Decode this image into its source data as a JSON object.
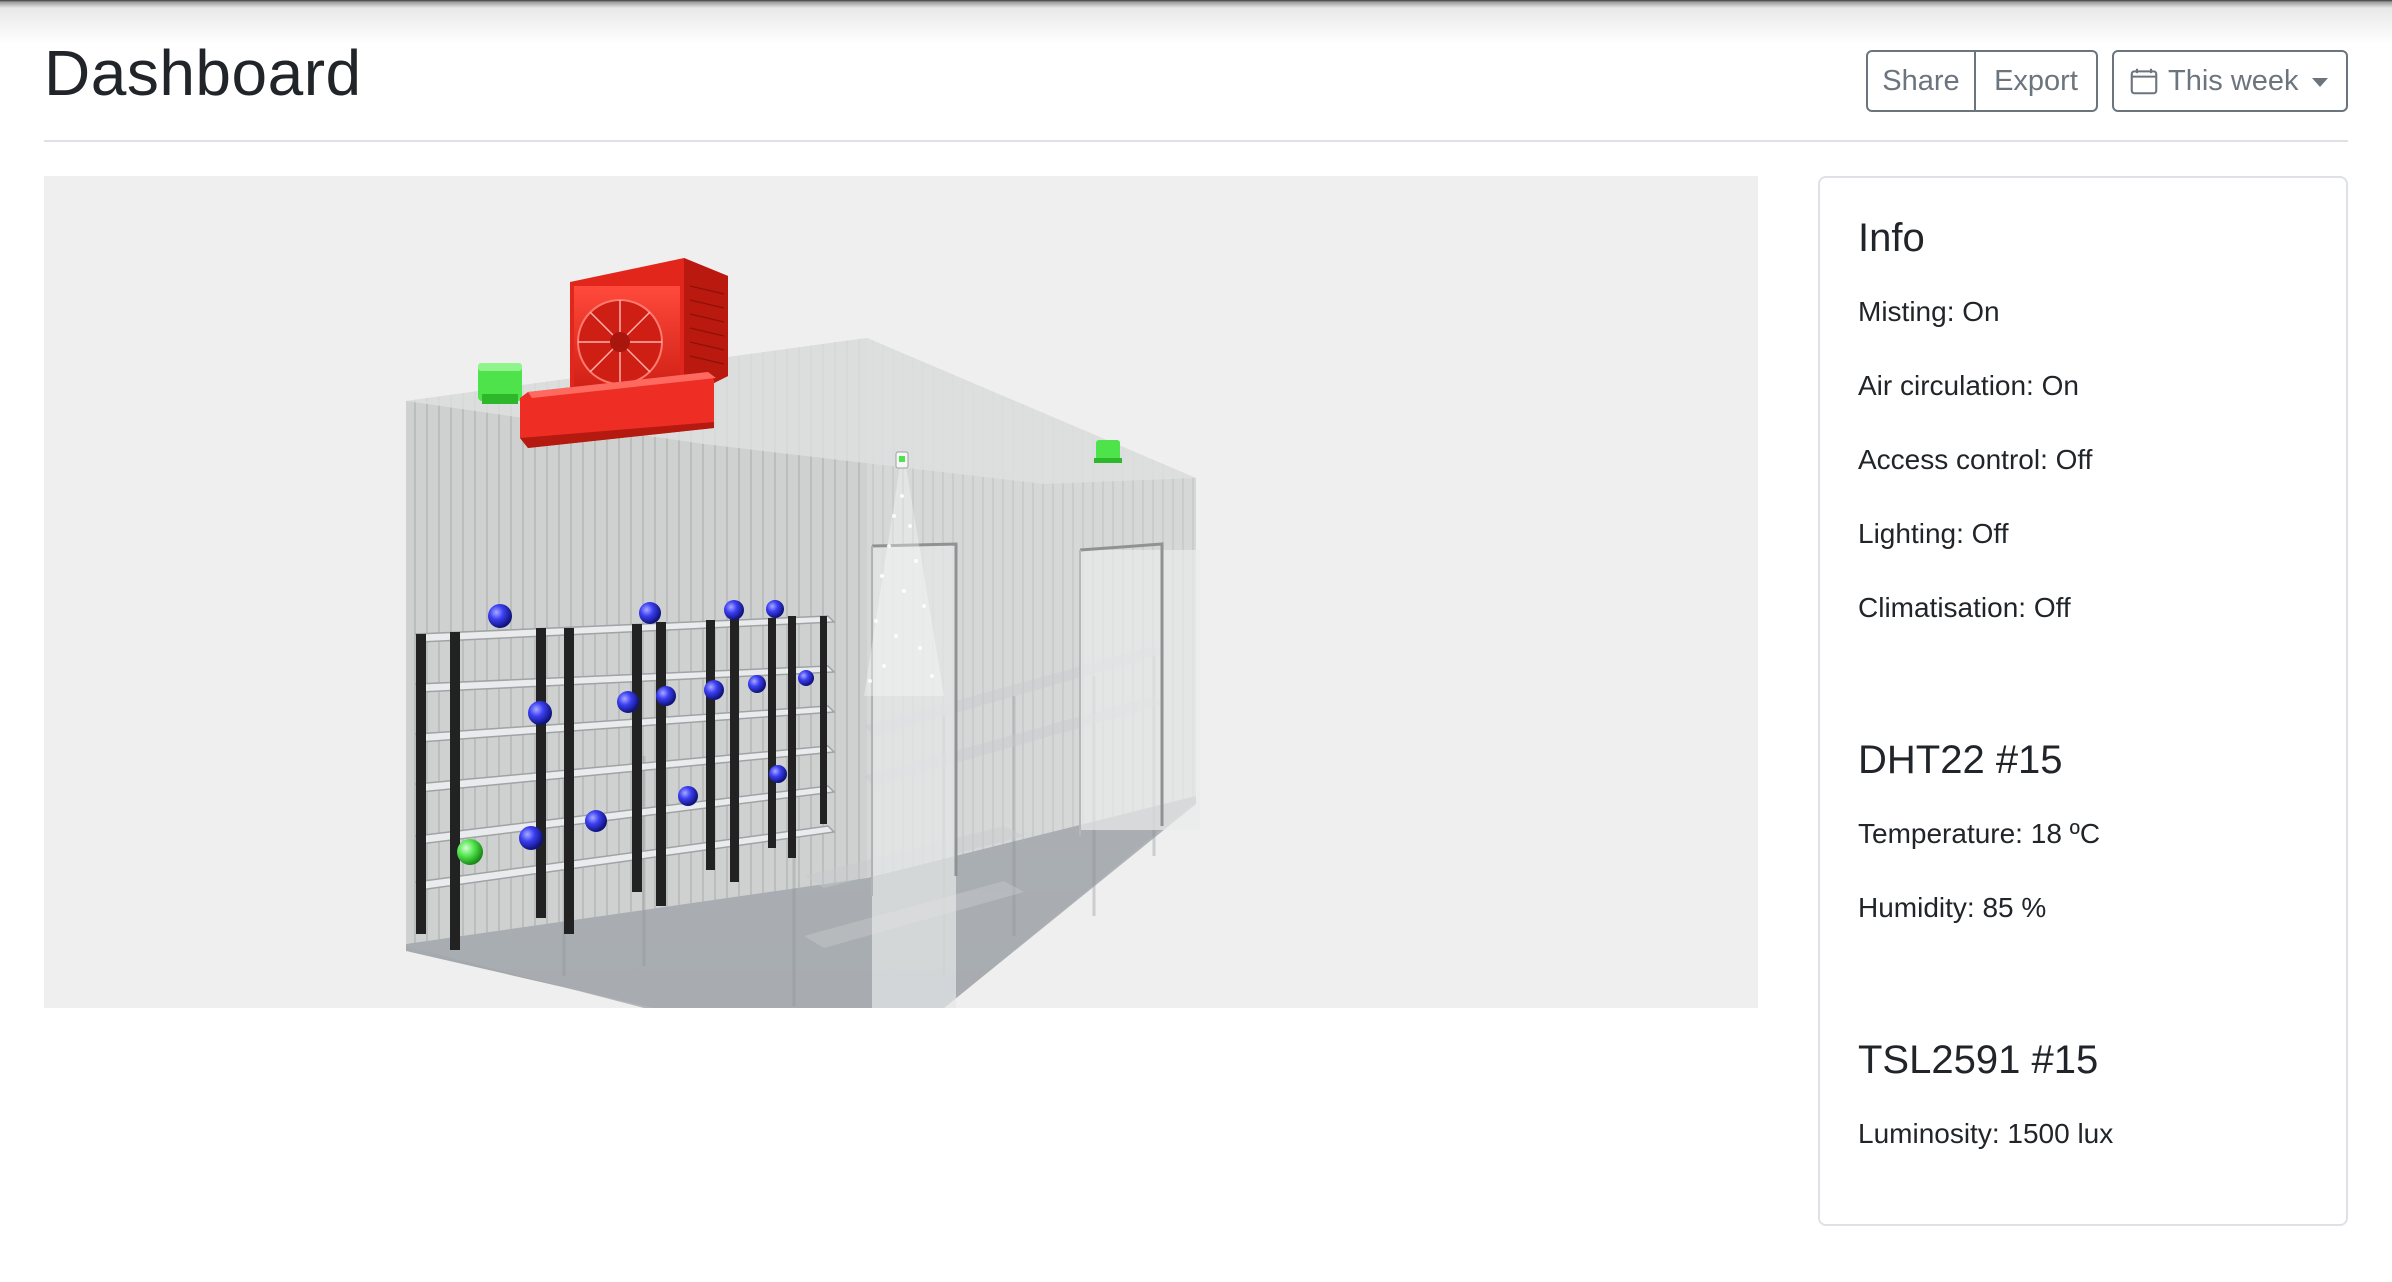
{
  "page": {
    "title": "Dashboard"
  },
  "toolbar": {
    "share_label": "Share",
    "export_label": "Export",
    "range_label": "This week",
    "range_icon": "calendar-icon"
  },
  "scene": {
    "description_icon": "3d-greenhouse-view",
    "colors": {
      "background": "#efefef",
      "ac_unit": "#ee2e24",
      "sensor_active": "#5ef05a",
      "sensor_node": "#2a2ff0"
    }
  },
  "info": {
    "title": "Info",
    "items": [
      "Misting: On",
      "Air circulation: On",
      "Access control: Off",
      "Lighting: Off",
      "Climatisation: Off"
    ]
  },
  "dht22": {
    "title": "DHT22 #15",
    "temperature": "Temperature: 18 ºC",
    "humidity": "Humidity: 85 %"
  },
  "tsl2591": {
    "title": "TSL2591 #15",
    "luminosity": "Luminosity: 1500 lux"
  }
}
